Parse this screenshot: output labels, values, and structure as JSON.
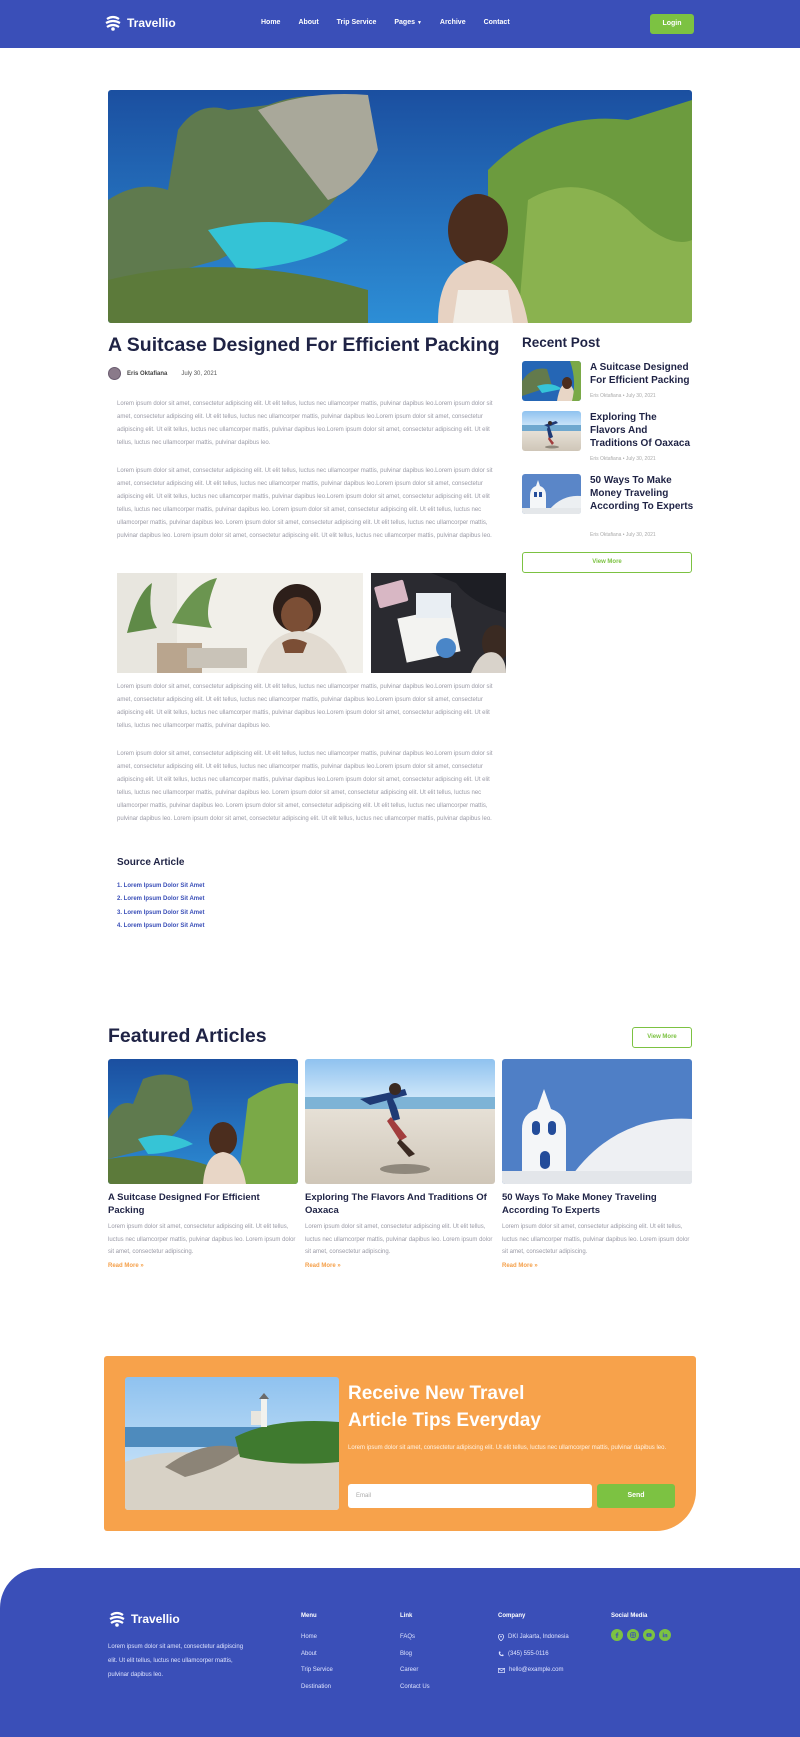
{
  "brand": {
    "name": "Travellio"
  },
  "nav": {
    "items": [
      "Home",
      "About",
      "Trip Service",
      "Pages",
      "Archive",
      "Contact"
    ],
    "login_label": "Login"
  },
  "article": {
    "title": "A Suitcase Designed For Efficient Packing",
    "author": "Eris Oktafiana",
    "date": "July 30, 2021",
    "paragraphs": [
      "Lorem ipsum dolor sit amet, consectetur adipiscing elit. Ut elit tellus, luctus nec ullamcorper mattis, pulvinar dapibus leo.Lorem ipsum dolor sit amet, consectetur adipiscing elit. Ut elit tellus, luctus nec ullamcorper mattis, pulvinar dapibus leo.Lorem ipsum dolor sit amet, consectetur adipiscing elit. Ut elit tellus, luctus nec ullamcorper mattis, pulvinar dapibus leo.Lorem ipsum dolor sit amet, consectetur adipiscing elit. Ut elit tellus, luctus nec ullamcorper mattis, pulvinar dapibus leo.",
      "Lorem ipsum dolor sit amet, consectetur adipiscing elit. Ut elit tellus, luctus nec ullamcorper mattis, pulvinar dapibus leo.Lorem ipsum dolor sit amet, consectetur adipiscing elit. Ut elit tellus, luctus nec ullamcorper mattis, pulvinar dapibus leo.Lorem ipsum dolor sit amet, consectetur adipiscing elit. Ut elit tellus, luctus nec ullamcorper mattis, pulvinar dapibus leo.Lorem ipsum dolor sit amet, consectetur adipiscing elit. Ut elit tellus, luctus nec ullamcorper mattis, pulvinar dapibus leo. Lorem ipsum dolor sit amet, consectetur adipiscing elit. Ut elit tellus, luctus nec ullamcorper mattis, pulvinar dapibus leo. Lorem ipsum dolor sit amet, consectetur adipiscing elit. Ut elit tellus, luctus nec ullamcorper mattis, pulvinar dapibus leo. Lorem ipsum dolor sit amet, consectetur adipiscing elit. Ut elit tellus, luctus nec ullamcorper mattis, pulvinar dapibus leo.",
      "Lorem ipsum dolor sit amet, consectetur adipiscing elit. Ut elit tellus, luctus nec ullamcorper mattis, pulvinar dapibus leo.Lorem ipsum dolor sit amet, consectetur adipiscing elit. Ut elit tellus, luctus nec ullamcorper mattis, pulvinar dapibus leo.Lorem ipsum dolor sit amet, consectetur adipiscing elit. Ut elit tellus, luctus nec ullamcorper mattis, pulvinar dapibus leo.Lorem ipsum dolor sit amet, consectetur adipiscing elit. Ut elit tellus, luctus nec ullamcorper mattis, pulvinar dapibus leo.",
      "Lorem ipsum dolor sit amet, consectetur adipiscing elit. Ut elit tellus, luctus nec ullamcorper mattis, pulvinar dapibus leo.Lorem ipsum dolor sit amet, consectetur adipiscing elit. Ut elit tellus, luctus nec ullamcorper mattis, pulvinar dapibus leo.Lorem ipsum dolor sit amet, consectetur adipiscing elit. Ut elit tellus, luctus nec ullamcorper mattis, pulvinar dapibus leo.Lorem ipsum dolor sit amet, consectetur adipiscing elit. Ut elit tellus, luctus nec ullamcorper mattis, pulvinar dapibus leo. Lorem ipsum dolor sit amet, consectetur adipiscing elit. Ut elit tellus, luctus nec ullamcorper mattis, pulvinar dapibus leo. Lorem ipsum dolor sit amet, consectetur adipiscing elit. Ut elit tellus, luctus nec ullamcorper mattis, pulvinar dapibus leo. Lorem ipsum dolor sit amet, consectetur adipiscing elit. Ut elit tellus, luctus nec ullamcorper mattis, pulvinar dapibus leo."
    ],
    "source_title": "Source Article",
    "sources": [
      "1. Lorem Ipsum Dolor Sit Amet",
      "2. Lorem Ipsum Dolor Sit Amet",
      "3. Lorem Ipsum Dolor Sit Amet",
      "4. Lorem Ipsum Dolor Sit Amet"
    ]
  },
  "sidebar": {
    "title": "Recent Post",
    "posts": [
      {
        "title": "A Suitcase Designed For Efficient Packing",
        "meta": "Eris Oktafiana • July 30, 2021"
      },
      {
        "title": "Exploring The Flavors And Traditions Of Oaxaca",
        "meta": "Eris Oktafiana • July 30, 2021"
      },
      {
        "title": "50 Ways To Make Money Traveling According To Experts",
        "meta": "Eris Oktafiana • July 30, 2021"
      }
    ],
    "view_more": "View More"
  },
  "featured": {
    "title": "Featured Articles",
    "view_more": "View More",
    "cards": [
      {
        "title": "A Suitcase Designed For Efficient Packing",
        "text": "Lorem ipsum dolor sit amet, consectetur adipiscing elit. Ut elit tellus, luctus nec ullamcorper mattis, pulvinar dapibus leo. Lorem ipsum dolor sit amet, consectetur adipiscing.",
        "read_more": "Read More »"
      },
      {
        "title": "Exploring The Flavors And Traditions Of Oaxaca",
        "text": "Lorem ipsum dolor sit amet, consectetur adipiscing elit. Ut elit tellus, luctus nec ullamcorper mattis, pulvinar dapibus leo. Lorem ipsum dolor sit amet, consectetur adipiscing.",
        "read_more": "Read More »"
      },
      {
        "title": "50 Ways To Make Money Traveling According To Experts",
        "text": "Lorem ipsum dolor sit amet, consectetur adipiscing elit. Ut elit tellus, luctus nec ullamcorper mattis, pulvinar dapibus leo. Lorem ipsum dolor sit amet, consectetur adipiscing.",
        "read_more": "Read More »"
      }
    ]
  },
  "newsletter": {
    "title_line1": "Receive New Travel",
    "title_line2": "Article Tips Everyday",
    "text": "Lorem ipsum dolor sit amet, consectetur adipiscing elit. Ut elit tellus, luctus nec ullamcorper mattis, pulvinar dapibus leo.",
    "email_placeholder": "Email",
    "send_label": "Send"
  },
  "footer": {
    "about": "Lorem ipsum dolor sit amet, consectetur adipiscing elit. Ut elit tellus, luctus nec ullamcorper mattis, pulvinar dapibus leo.",
    "menu_title": "Menu",
    "menu": [
      "Home",
      "About",
      "Trip Service",
      "Destination"
    ],
    "link_title": "Link",
    "links": [
      "FAQs",
      "Blog",
      "Career",
      "Contact Us"
    ],
    "company_title": "Company",
    "company": [
      "DKI Jakarta, Indonesia",
      "(345) 555-0116",
      "hello@example.com"
    ],
    "social_title": "Social Media",
    "socials": [
      "facebook-icon",
      "instagram-icon",
      "youtube-icon",
      "linkedin-icon"
    ]
  },
  "colors": {
    "primary": "#3a4fb8",
    "accent_green": "#7cc242",
    "accent_orange": "#f7a24b",
    "heading": "#1f2345"
  }
}
